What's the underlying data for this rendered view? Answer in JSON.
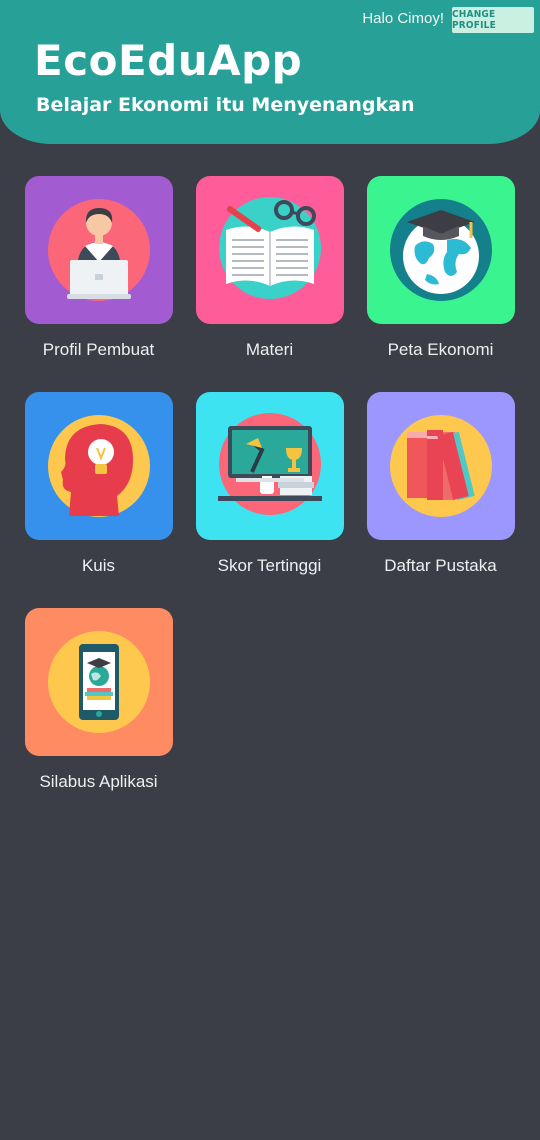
{
  "header": {
    "greeting": "Halo Cimoy!",
    "change_profile": "CHANGE PROFILE",
    "title": "EcoEduApp",
    "subtitle": "Belajar Ekonomi itu Menyenangkan"
  },
  "menu": [
    {
      "label": "Profil Pembuat",
      "icon": "woman-laptop-icon",
      "color": "#a35bd1"
    },
    {
      "label": "Materi",
      "icon": "book-glasses-icon",
      "color": "#ff5c9a"
    },
    {
      "label": "Peta Ekonomi",
      "icon": "globe-graduation-cap-icon",
      "color": "#3af58f"
    },
    {
      "label": "Kuis",
      "icon": "head-lightbulb-icon",
      "color": "#3591ec"
    },
    {
      "label": "Skor Tertinggi",
      "icon": "desk-trophy-icon",
      "color": "#3ee3f1"
    },
    {
      "label": "Daftar Pustaka",
      "icon": "books-icon",
      "color": "#9b97ff"
    },
    {
      "label": "Silabus Aplikasi",
      "icon": "phone-globe-icon",
      "color": "#ff8b62"
    }
  ]
}
